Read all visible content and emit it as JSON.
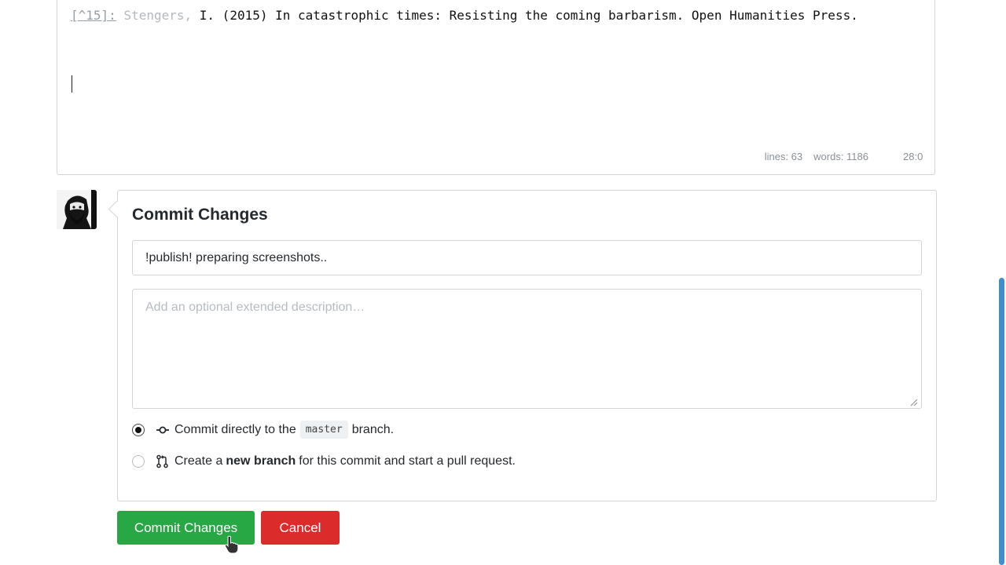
{
  "editor": {
    "footnote_ref": "[^15]:",
    "footnote_author": "Stengers,",
    "footnote_text": "I. (2015) In catastrophic times: Resisting the coming barbarism. Open Humanities Press.",
    "status_lines": "lines: 63",
    "status_words": "words: 1186",
    "status_position": "28:0"
  },
  "commit": {
    "title": "Commit Changes",
    "summary_value": "!publish! preparing screenshots..",
    "description_placeholder": "Add an optional extended description…",
    "option_direct": {
      "prefix": "Commit directly to the",
      "branch": "master",
      "suffix": "branch.",
      "selected": true
    },
    "option_new_branch": {
      "prefix": "Create a",
      "bold": "new branch",
      "suffix": "for this commit and start a pull request.",
      "selected": false
    }
  },
  "buttons": {
    "commit_label": "Commit Changes",
    "cancel_label": "Cancel"
  },
  "colors": {
    "commit_button": "#28a745",
    "cancel_button": "#dc2b2b",
    "scrollbar": "#3e8fd0"
  },
  "icons": {
    "avatar": "user-avatar",
    "direct_commit": "git-commit-icon",
    "new_branch": "git-pull-request-icon"
  }
}
